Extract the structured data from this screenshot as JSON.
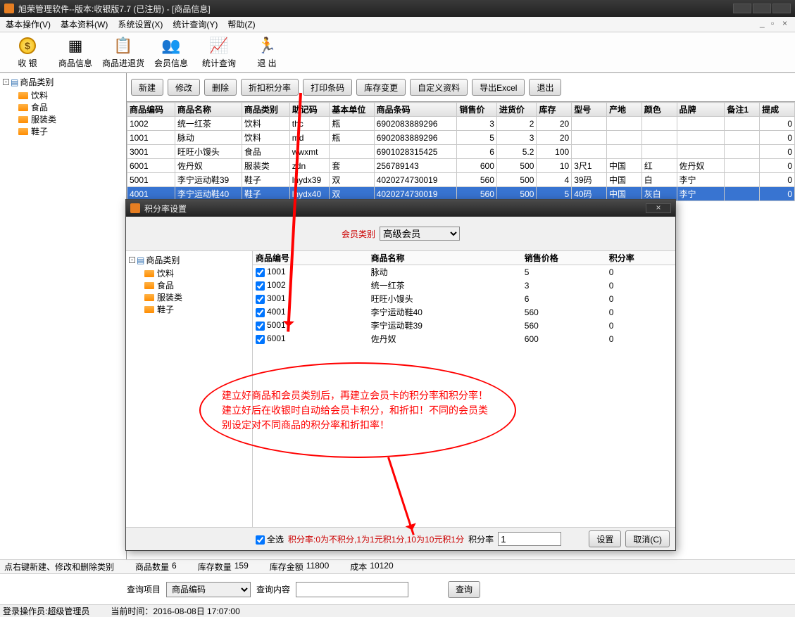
{
  "window": {
    "title": "旭荣管理软件--版本:收银版7.7 (已注册) - [商品信息]"
  },
  "menubar": {
    "items": [
      "基本操作(V)",
      "基本资料(W)",
      "系统设置(X)",
      "统计查询(Y)",
      "帮助(Z)"
    ]
  },
  "toolbar": {
    "items": [
      {
        "label": "收 银",
        "glyph": "coin"
      },
      {
        "label": "商品信息",
        "glyph": "🧾"
      },
      {
        "label": "商品进退货",
        "glyph": "📄"
      },
      {
        "label": "会员信息",
        "glyph": "👥"
      },
      {
        "label": "统计查询",
        "glyph": "📊"
      },
      {
        "label": "退 出",
        "glyph": "🚶"
      }
    ]
  },
  "tree": {
    "root": "商品类别",
    "children": [
      "饮料",
      "食品",
      "服装类",
      "鞋子"
    ]
  },
  "buttons": [
    "新建",
    "修改",
    "删除",
    "折扣积分率",
    "打印条码",
    "库存变更",
    "自定义资料",
    "导出Excel",
    "退出"
  ],
  "grid": {
    "columns": [
      "商品编码",
      "商品名称",
      "商品类别",
      "助记码",
      "基本单位",
      "商品条码",
      "销售价",
      "进货价",
      "库存",
      "型号",
      "产地",
      "颜色",
      "品牌",
      "备注1",
      "提成"
    ],
    "rows": [
      {
        "c": [
          "1002",
          "统一红茶",
          "饮料",
          "thc",
          "瓶",
          "6902083889296",
          "3",
          "2",
          "20",
          "",
          "",
          "",
          "",
          "",
          "0"
        ]
      },
      {
        "c": [
          "1001",
          "脉动",
          "饮料",
          "md",
          "瓶",
          "6902083889296",
          "5",
          "3",
          "20",
          "",
          "",
          "",
          "",
          "",
          "0"
        ]
      },
      {
        "c": [
          "3001",
          "旺旺小馒头",
          "食品",
          "wwxmt",
          "",
          "6901028315425",
          "6",
          "5.2",
          "100",
          "",
          "",
          "",
          "",
          "",
          "0"
        ]
      },
      {
        "c": [
          "6001",
          "佐丹奴",
          "服装类",
          "zdn",
          "套",
          "256789143",
          "600",
          "500",
          "10",
          "3尺1",
          "中国",
          "红",
          "佐丹奴",
          "",
          "0"
        ]
      },
      {
        "c": [
          "5001",
          "李宁运动鞋39",
          "鞋子",
          "lnydx39",
          "双",
          "4020274730019",
          "560",
          "500",
          "4",
          "39码",
          "中国",
          "白",
          "李宁",
          "",
          "0"
        ]
      },
      {
        "c": [
          "4001",
          "李宁运动鞋40",
          "鞋子",
          "lnydx40",
          "双",
          "4020274730019",
          "560",
          "500",
          "5",
          "40码",
          "中国",
          "灰白",
          "李宁",
          "",
          "0"
        ],
        "sel": true
      }
    ]
  },
  "footer": {
    "hint": "点右键新建、修改和删除类别",
    "stats": [
      [
        "商品数量",
        "6"
      ],
      [
        "库存数量",
        "159"
      ],
      [
        "库存金额",
        "11800"
      ],
      [
        "成本",
        "10120"
      ]
    ]
  },
  "search": {
    "label1": "查询项目",
    "select": "商品编码",
    "label2": "查询内容",
    "value": "",
    "btn": "查询"
  },
  "statusbar": {
    "user": "登录操作员:超级管理员",
    "time": "当前时间：2016-08-08日 17:07:00"
  },
  "dialog": {
    "title": "积分率设置",
    "filter_label": "会员类别",
    "filter_value": "高级会员",
    "tree_root": "商品类别",
    "tree_children": [
      "饮料",
      "食品",
      "服装类",
      "鞋子"
    ],
    "columns": [
      "商品编号",
      "商品名称",
      "销售价格",
      "积分率"
    ],
    "rows": [
      {
        "id": "1001",
        "name": "脉动",
        "price": "5",
        "rate": "0"
      },
      {
        "id": "1002",
        "name": "统一红茶",
        "price": "3",
        "rate": "0"
      },
      {
        "id": "3001",
        "name": "旺旺小馒头",
        "price": "6",
        "rate": "0"
      },
      {
        "id": "4001",
        "name": "李宁运动鞋40",
        "price": "560",
        "rate": "0"
      },
      {
        "id": "5001",
        "name": "李宁运动鞋39",
        "price": "560",
        "rate": "0"
      },
      {
        "id": "6001",
        "name": "佐丹奴",
        "price": "600",
        "rate": "0"
      }
    ],
    "select_all": "全选",
    "rate_hint": "积分率:0为不积分,1为1元积1分,10为10元积1分",
    "rate_label": "积分率",
    "rate_value": "1",
    "ok": "设置",
    "cancel": "取消(C)"
  },
  "annotation": "建立好商品和会员类别后，再建立会员卡的积分率和积分率！建立好后在收银时自动给会员卡积分，和折扣！不同的会员类别设定对不同商品的积分率和折扣率！"
}
